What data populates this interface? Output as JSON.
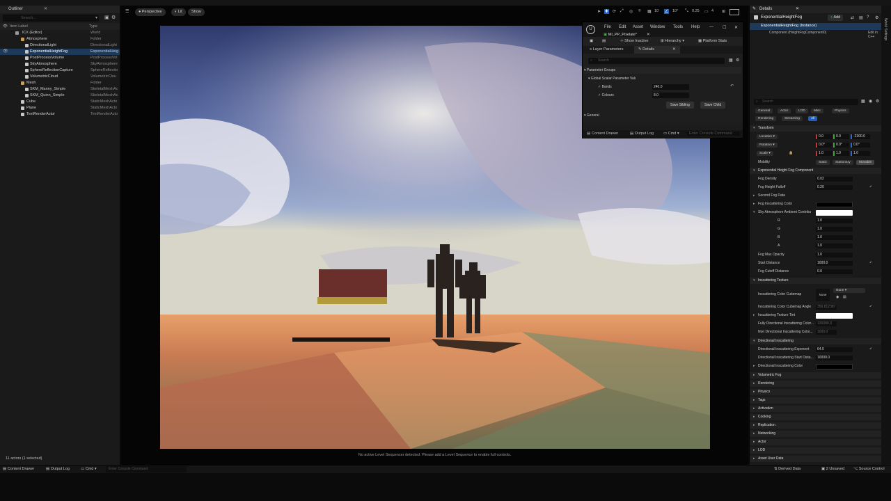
{
  "outliner": {
    "tab_label": "Outliner",
    "search_placeholder": "Search...",
    "col_label": "Item Label",
    "col_type": "Type",
    "rows": [
      {
        "label": "lCX (Editor)",
        "type": "World"
      },
      {
        "label": "Atmosphere",
        "type": "Folder"
      },
      {
        "label": "DirectionalLight",
        "type": "DirectionalLight"
      },
      {
        "label": "ExponentialHeightFog",
        "type": "ExponentialHeig"
      },
      {
        "label": "PostProcessVolume",
        "type": "PostProcessVol"
      },
      {
        "label": "SkyAtmosphere",
        "type": "SkyAtmosphere"
      },
      {
        "label": "SphereReflectionCapture",
        "type": "SphereReflectio"
      },
      {
        "label": "VolumetricCloud",
        "type": "VolumetricClou"
      },
      {
        "label": "Mesh",
        "type": "Folder"
      },
      {
        "label": "SKM_Manny_Simple",
        "type": "SkeletalMeshAc"
      },
      {
        "label": "SKM_Quinn_Simple",
        "type": "SkeletalMeshAc"
      },
      {
        "label": "Cube",
        "type": "StaticMeshActo"
      },
      {
        "label": "Plane",
        "type": "StaticMeshActo"
      },
      {
        "label": "TextRenderActor",
        "type": "TextRenderActo"
      }
    ],
    "footer": "11 actors (1 selected)"
  },
  "viewport": {
    "perspective": "Perspective",
    "lit": "Lit",
    "show": "Show",
    "grid_snap": "10",
    "rot_snap": "10°",
    "scale_snap": "0.25",
    "cam_speed": "4",
    "message": "No active Level Sequencer detected. Please add a Level Sequence to enable full controls."
  },
  "material_editor": {
    "menu": [
      "File",
      "Edit",
      "Asset",
      "Window",
      "Tools",
      "Help"
    ],
    "tab": "MI_PP_Pixelate*",
    "show_inactive": "Show Inactive",
    "hierarchy": "Hierarchy",
    "platform_stats": "Platform Stats",
    "layer_params": "Layer Parameters",
    "details": "Details",
    "search_placeholder": "Search",
    "param_groups": "Parameter Groups",
    "group_name": "Global Scalar Parameter Valı",
    "bands_label": "Bands",
    "bands_value": "240.0",
    "colours_label": "Colours",
    "colours_value": "8.0",
    "save_sibling": "Save Sibling",
    "save_child": "Save Child",
    "general": "General",
    "content_drawer": "Content Drawer",
    "output_log": "Output Log",
    "cmd": "Cmd",
    "console_placeholder": "Enter Console Command"
  },
  "details": {
    "tab_label": "Details",
    "actor_name": "ExponentialHeightFog",
    "add_label": "Add",
    "instance": "ExponentialHeightFog (Instance)",
    "component": "Component (HeightFogComponent0)",
    "edit_cpp": "Edit in C++",
    "search_placeholder": "Search",
    "filters_row1": [
      "General",
      "Actor",
      "LOD",
      "Misc",
      "Physics"
    ],
    "filters_row2": [
      "Rendering",
      "Streaming",
      "All"
    ],
    "transform": "Transform",
    "location": "Location",
    "rotation": "Rotation",
    "scale": "Scale",
    "loc_vals": [
      "0.0",
      "0.0",
      "-2300.0"
    ],
    "rot_vals": [
      "0.0°",
      "0.0°",
      "0.0°"
    ],
    "scale_vals": [
      "1.0",
      "1.0",
      "1.0"
    ],
    "mobility": "Mobility",
    "mob_opts": [
      "Static",
      "Stationary",
      "Movable"
    ],
    "fog_comp": "Exponential Height Fog Component",
    "fog_density": "Fog Density",
    "fog_density_v": "0.02",
    "fog_falloff": "Fog Height Falloff",
    "fog_falloff_v": "0.20",
    "second_fog": "Second Fog Data",
    "fog_inscat": "Fog Inscattering Color",
    "sky_ambient": "Sky Atmosphere Ambient Contribu",
    "r": "R",
    "g": "G",
    "b": "B",
    "a": "A",
    "r_v": "1.0",
    "g_v": "1.0",
    "b_v": "1.0",
    "a_v": "1.0",
    "fog_max_op": "Fog Max Opacity",
    "fog_max_op_v": "1.0",
    "start_dist": "Start Distance",
    "start_dist_v": "1000.0",
    "cutoff": "Fog Cutoff Distance",
    "cutoff_v": "0.0",
    "inscat_tex": "Inscattering Texture",
    "cubemap": "Inscattering Color Cubemap",
    "cubemap_none": "None",
    "cubemap_thumb": "None",
    "cubemap_angle": "Inscattering Color Cubemap Angle",
    "cubemap_angle_v": "359.812387",
    "tex_tint": "Inscattering Texture Tint",
    "fully_dir": "Fully Directional Inscattering Color...",
    "fully_dir_v": "100000.0",
    "non_dir": "Non Directional Inscattering Color...",
    "non_dir_v": "1000.0",
    "dir_inscat": "Directional Inscattering",
    "dir_exp": "Directional Inscattering Exponent",
    "dir_exp_v": "64.0",
    "dir_start": "Directional Inscattering Start Dista...",
    "dir_start_v": "10000.0",
    "dir_color": "Directional Inscattering Color",
    "sections": [
      "Volumetric Fog",
      "Rendering",
      "Physics",
      "Tags",
      "Activation",
      "Cooking",
      "Replication",
      "Networking",
      "Actor",
      "LOD",
      "Asset User Data"
    ],
    "world_settings": "World Settings"
  },
  "bottombar": {
    "content_drawer": "Content Drawer",
    "output_log": "Output Log",
    "cmd": "Cmd",
    "console_placeholder": "Enter Console Command",
    "derived_data": "Derived Data",
    "unsaved": "2 Unsaved",
    "source_control": "Source Control"
  },
  "colors": {
    "selection": "#1d3a5a",
    "accent": "#1f5fbf",
    "panel": "#1a1a1a"
  }
}
